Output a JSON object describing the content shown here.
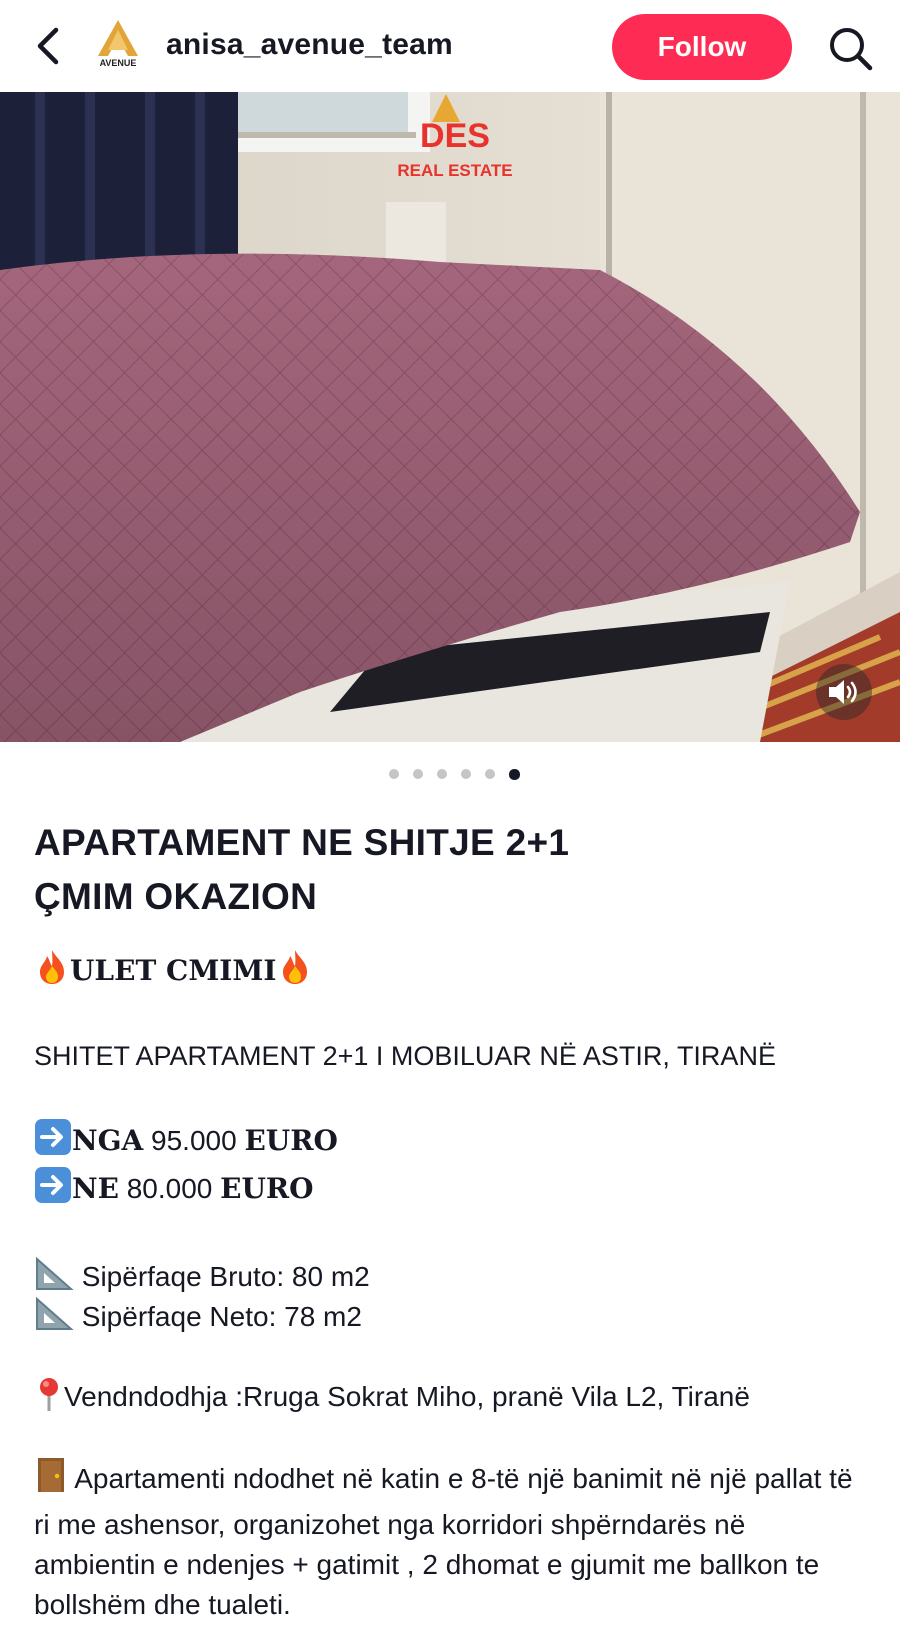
{
  "header": {
    "username": "anisa_avenue_team",
    "follow_label": "Follow",
    "avatar_brand": "AVENUE"
  },
  "photo": {
    "watermark_line1": "DES",
    "watermark_line2": "REAL ESTATE",
    "slide_count": 6,
    "active_slide": 6
  },
  "post": {
    "title_line1": "APARTAMENT NE SHITJE 2+1",
    "title_line2": "ÇMIM OKAZION",
    "price_drop": "ULET CMIMI",
    "headline": "SHITET  APARTAMENT 2+1 I MOBILUAR NË ASTIR, TIRANË",
    "price_from_label": "NGA",
    "price_from_value": "95.000",
    "price_from_currency": "EURO",
    "price_to_label": "NE",
    "price_to_value": "80.000",
    "price_to_currency": "EURO",
    "area_gross": "Sipërfaqe Bruto: 80 m2",
    "area_net": "Sipërfaqe Neto: 78 m2",
    "location": "Vendndodhja :Rruga Sokrat Miho, pranë Vila L2, Tiranë",
    "description": "Apartamenti ndodhet në katin e 8-të një banimit në një pallat  të ri me ashensor, organizohet nga korridori shpërndarës në ambientin e ndenjes + gatimit ,  2 dhomat e gjumit me ballkon te bollshëm dhe  tualeti."
  },
  "colors": {
    "follow_bg": "#fe2c55",
    "text": "#161823",
    "watermark": "#e8322b"
  },
  "icons": [
    "back-chevron-icon",
    "search-icon",
    "volume-icon",
    "fire-icon",
    "arrow-right-icon",
    "triangular-ruler-icon",
    "pin-icon",
    "door-icon"
  ]
}
